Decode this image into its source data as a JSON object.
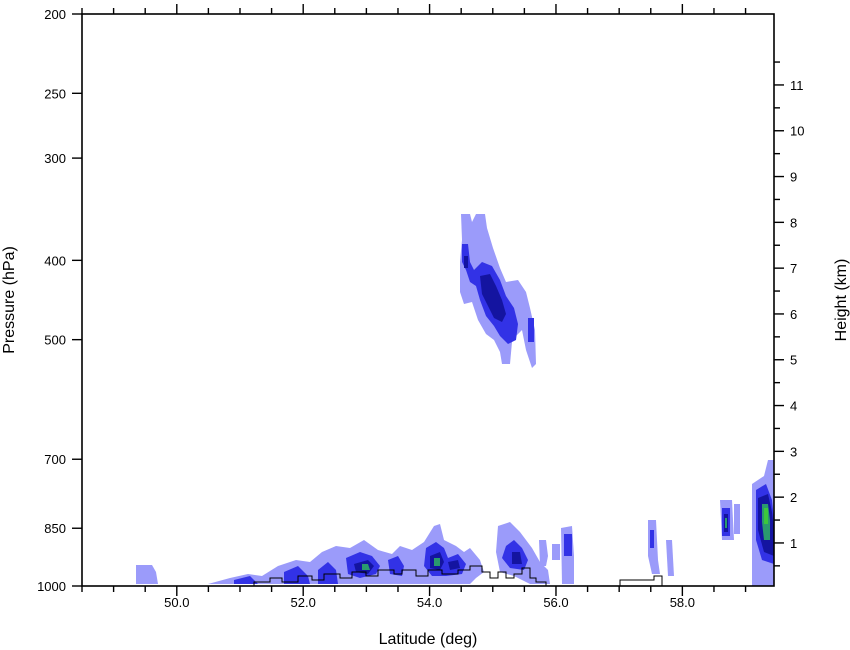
{
  "chart_data": {
    "type": "contour",
    "x_axis": {
      "label": "Latitude (deg)",
      "range": [
        48.5,
        59.45
      ],
      "major_ticks": [
        50.0,
        52.0,
        54.0,
        56.0,
        58.0
      ],
      "tick_labels": [
        "50.0",
        "52.0",
        "54.0",
        "56.0",
        "58.0"
      ]
    },
    "y_axis_left": {
      "label": "Pressure (hPa)",
      "scale": "log",
      "range": [
        1000,
        200
      ],
      "ticks": [
        1000,
        850,
        700,
        500,
        400,
        300,
        250,
        200
      ],
      "tick_labels": [
        "1000",
        "850",
        "700",
        "500",
        "400",
        "300",
        "250",
        "200"
      ]
    },
    "y_axis_right": {
      "label": "Height (km)",
      "ticks": [
        1,
        2,
        3,
        4,
        5,
        6,
        7,
        8,
        9,
        10,
        11
      ],
      "tick_labels": [
        "1",
        "2",
        "3",
        "4",
        "5",
        "6",
        "7",
        "8",
        "9",
        "10",
        "11"
      ]
    },
    "contour_colors": [
      "#9b9bfa",
      "#3232e6",
      "#1414a0",
      "#2a9a6e",
      "#3cc83c"
    ],
    "features": [
      {
        "lat_range": [
          54.45,
          55.85
        ],
        "pressure_range": [
          365,
          525
        ],
        "peak_level": 3
      },
      {
        "lat_range": [
          50.5,
          56.5
        ],
        "pressure_range": [
          880,
          1000
        ],
        "peak_level": 5
      },
      {
        "lat_range": [
          49.3,
          49.7
        ],
        "pressure_range": [
          940,
          1000
        ],
        "peak_level": 1
      },
      {
        "lat_range": [
          58.6,
          58.8
        ],
        "pressure_range": [
          800,
          930
        ],
        "peak_level": 5
      },
      {
        "lat_range": [
          59.1,
          59.45
        ],
        "pressure_range": [
          700,
          1000
        ],
        "peak_level": 5
      }
    ]
  }
}
